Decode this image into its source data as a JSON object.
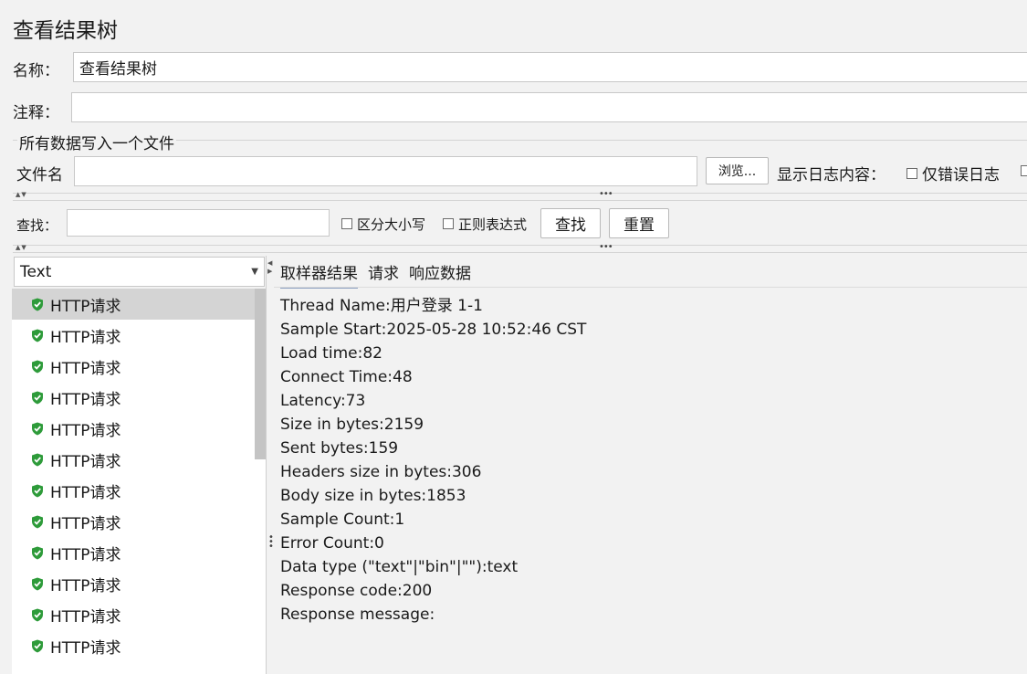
{
  "panel": {
    "title": "查看结果树"
  },
  "name_field": {
    "label": "名称：",
    "value": "查看结果树"
  },
  "comment_field": {
    "label": "注释：",
    "value": ""
  },
  "file_section": {
    "legend": "所有数据写入一个文件",
    "filename_label": "文件名",
    "filename_value": "",
    "browse_label": "浏览...",
    "log_content_label": "显示日志内容：",
    "errors_only_label": "仅错误日志"
  },
  "search_bar": {
    "label": "查找：",
    "value": "",
    "case_sensitive_label": "区分大小写",
    "regex_label": "正则表达式",
    "find_label": "查找",
    "reset_label": "重置"
  },
  "renderer_select": {
    "value": "Text"
  },
  "tree": {
    "items": [
      {
        "label": "HTTP请求",
        "status": "success"
      },
      {
        "label": "HTTP请求",
        "status": "success"
      },
      {
        "label": "HTTP请求",
        "status": "success"
      },
      {
        "label": "HTTP请求",
        "status": "success"
      },
      {
        "label": "HTTP请求",
        "status": "success"
      },
      {
        "label": "HTTP请求",
        "status": "success"
      },
      {
        "label": "HTTP请求",
        "status": "success"
      },
      {
        "label": "HTTP请求",
        "status": "success"
      },
      {
        "label": "HTTP请求",
        "status": "success"
      },
      {
        "label": "HTTP请求",
        "status": "success"
      },
      {
        "label": "HTTP请求",
        "status": "success"
      },
      {
        "label": "HTTP请求",
        "status": "success"
      }
    ]
  },
  "result_tabs": [
    "取样器结果",
    "请求",
    "响应数据"
  ],
  "sampler_result": [
    "Thread Name:用户登录 1-1",
    "Sample Start:2025-05-28 10:52:46 CST",
    "Load time:82",
    "Connect Time:48",
    "Latency:73",
    "Size in bytes:2159",
    "Sent bytes:159",
    "Headers size in bytes:306",
    "Body size in bytes:1853",
    "Sample Count:1",
    "Error Count:0",
    "Data type (\"text\"|\"bin\"|\"\"):text",
    "Response code:200",
    "Response message:"
  ],
  "colors": {
    "success_icon": "#2e9b3a",
    "selection": "#d4d4d4",
    "tab_underline": "#8ca0c0"
  }
}
